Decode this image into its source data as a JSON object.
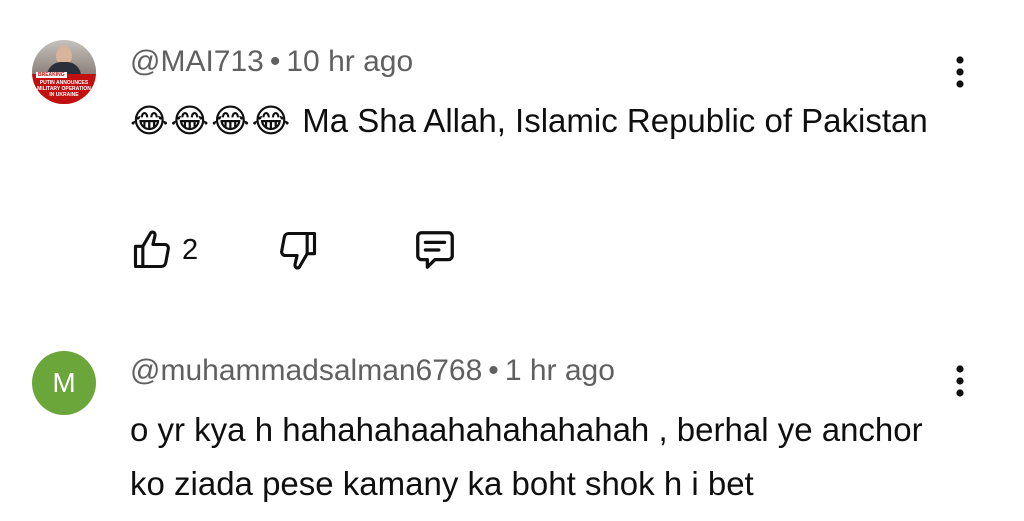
{
  "comments": [
    {
      "avatar": {
        "tag": "BREAKING",
        "caption": "PUTIN ANNOUNCES\nMILITARY OPERATION\nIN UKRAINE"
      },
      "author": "@MAI713",
      "separator": "•",
      "time": "10 hr ago",
      "emoji": "😂😂😂😂",
      "text": "Ma Sha Allah, Islamic Republic of Pakistan",
      "like_count": "2",
      "icons": {
        "like": "thumbs-up-icon",
        "dislike": "thumbs-down-icon",
        "reply": "reply-comment-icon",
        "more": "more-vertical-icon"
      }
    },
    {
      "avatar": {
        "letter": "M",
        "color": "#6aa63a"
      },
      "author": "@muhammadsalman6768",
      "separator": "•",
      "time": "1 hr ago",
      "text": "o yr kya h hahahahaahahahahahah ,  berhal ye anchor ko ziada pese kamany ka boht shok h i bet",
      "icons": {
        "more": "more-vertical-icon"
      }
    }
  ]
}
